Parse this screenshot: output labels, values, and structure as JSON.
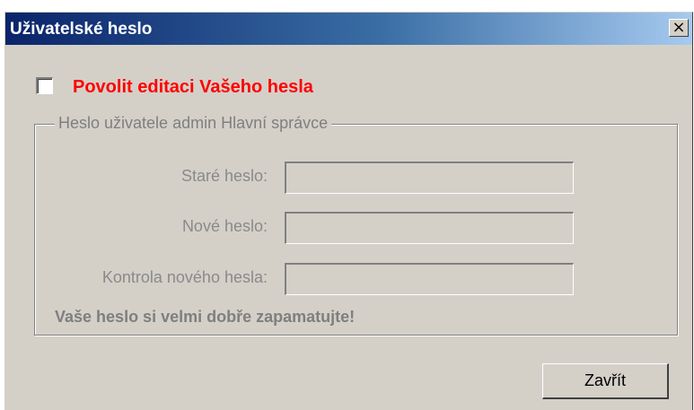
{
  "window": {
    "title": "Uživatelské heslo",
    "close_glyph": "×"
  },
  "enable_edit": {
    "label": "Povolit editaci Vašeho hesla",
    "checked": false,
    "color": "#ff0000"
  },
  "group": {
    "legend": "Heslo uživatele admin Hlavní správce",
    "fields": [
      {
        "label": "Staré heslo:",
        "value": ""
      },
      {
        "label": "Nové heslo:",
        "value": ""
      },
      {
        "label": "Kontrola nového hesla:",
        "value": ""
      }
    ],
    "warning": "Vaše heslo si velmi dobře zapamatujte!"
  },
  "buttons": {
    "close_label": "Zavřít"
  },
  "colors": {
    "dialog_background": "#d4d0c8",
    "titlebar_start": "#0a246a",
    "titlebar_end": "#a6caf0",
    "disabled_text": "#808080"
  }
}
